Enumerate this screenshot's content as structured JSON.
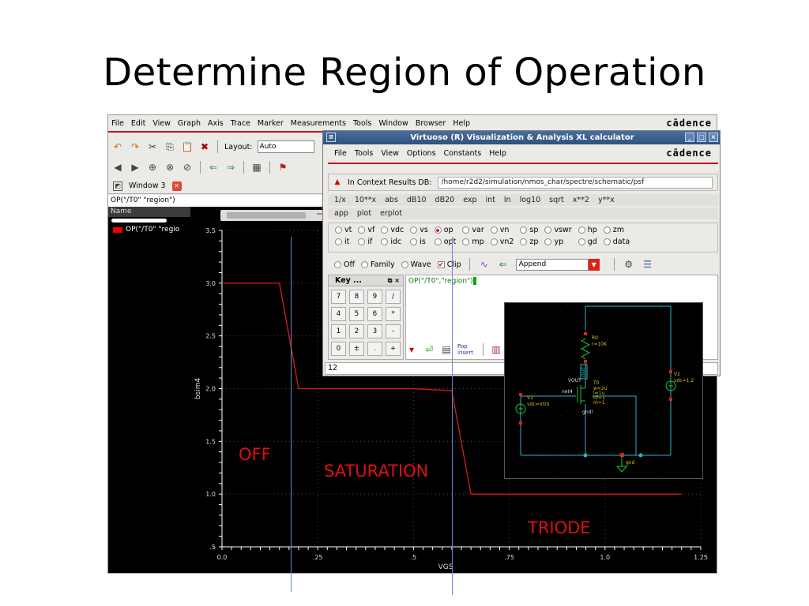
{
  "slide": {
    "title": "Determine Region of Operation"
  },
  "viewer": {
    "menu": [
      "File",
      "Edit",
      "View",
      "Graph",
      "Axis",
      "Trace",
      "Marker",
      "Measurements",
      "Tools",
      "Window",
      "Browser",
      "Help"
    ],
    "logo": "cādence",
    "layout_label": "Layout:",
    "layout_value": "Auto",
    "tab_label": "Window 3",
    "expression": "OP(\"/T0\" \"region\")",
    "panel_header": "Name",
    "trace_name": "OP(\"/T0\" \"regio",
    "colors": {
      "trace": "#cc1b1b",
      "axis": "#ffffff",
      "grid": "#444444",
      "marker_line": "#6a86d8"
    }
  },
  "chart_data": {
    "type": "line",
    "xlabel": "VGS",
    "ylabel": "bsim4",
    "xlim": [
      0,
      1.25
    ],
    "ylim": [
      0.5,
      3.5
    ],
    "x_ticks": [
      "0.0",
      ".25",
      ".5",
      ".75",
      "1.0",
      "1.25"
    ],
    "y_ticks": [
      "3.5",
      "3.0",
      "2.5",
      "2.0",
      "1.5",
      "1.0",
      ".5"
    ],
    "x_tick_values": [
      0,
      0.25,
      0.5,
      0.75,
      1.0,
      1.25
    ],
    "y_tick_values": [
      3.5,
      3.0,
      2.5,
      2.0,
      1.5,
      1.0,
      0.5
    ],
    "series": [
      {
        "x": [
          0,
          0.15,
          0.2,
          0.5,
          0.6,
          0.65,
          1.2
        ],
        "y": [
          3,
          3,
          2,
          2,
          1.98,
          1,
          1
        ]
      }
    ],
    "marker_lines_x": [
      0.18,
      0.6
    ],
    "annotations": [
      "OFF",
      "SATURATION",
      "TRIODE"
    ]
  },
  "calculator": {
    "title": "Virtuoso (R) Visualization & Analysis XL calculator",
    "menu": [
      "File",
      "Tools",
      "View",
      "Options",
      "Constants",
      "Help"
    ],
    "logo": "cādence",
    "ctx_label": "In Context Results DB:",
    "ctx_value": "/home/r2d2/simulation/nmos_char/spectre/schematic/psf",
    "functions": [
      "1/x",
      "10**x",
      "abs",
      "dB10",
      "dB20",
      "exp",
      "int",
      "ln",
      "log10",
      "sqrt",
      "x**2",
      "y**x"
    ],
    "functions2": [
      "app",
      "plot",
      "erplot"
    ],
    "radios_row1": [
      "vt",
      "vf",
      "vdc",
      "vs",
      "op",
      "var",
      "vn",
      "sp",
      "vswr",
      "hp",
      "zm"
    ],
    "radios_row2": [
      "it",
      "if",
      "idc",
      "is",
      "opt",
      "mp",
      "vn2",
      "zp",
      "yp",
      "gd",
      "data"
    ],
    "selected_radio": "op",
    "mode_items": [
      "Off",
      "Family",
      "Wave",
      "Clip"
    ],
    "append_value": "Append",
    "keypad_title": "Key ...",
    "keypad_keys": [
      "7",
      "8",
      "9",
      "/",
      "4",
      "5",
      "6",
      "*",
      "1",
      "2",
      "3",
      "-",
      "0",
      "±",
      ".",
      "+"
    ],
    "expression": "OP(\"/T0\",\"region\")",
    "stack_count": "12",
    "pop_insert": "Pop insert"
  },
  "schematic": {
    "r0_name": "R0",
    "r0_value": "r=10K",
    "vout": "VOUT",
    "out_label": "OUT",
    "net4": "net4",
    "t0_name": "T0",
    "t0_params": [
      "w=2u",
      "l=1u",
      "nf=1",
      "m=1"
    ],
    "gnd_label": "gnd!",
    "v1_name": "V1",
    "v1_value": "vdc=VGS",
    "v2_name": "V2",
    "v2_value": "vdc=1.2",
    "gnd_bottom": "gnd",
    "colors": {
      "wire": "#2bb3c2",
      "comp": "#23c23d",
      "label": "#e0c014",
      "pin": "#d21",
      "bg": "#000000"
    }
  }
}
